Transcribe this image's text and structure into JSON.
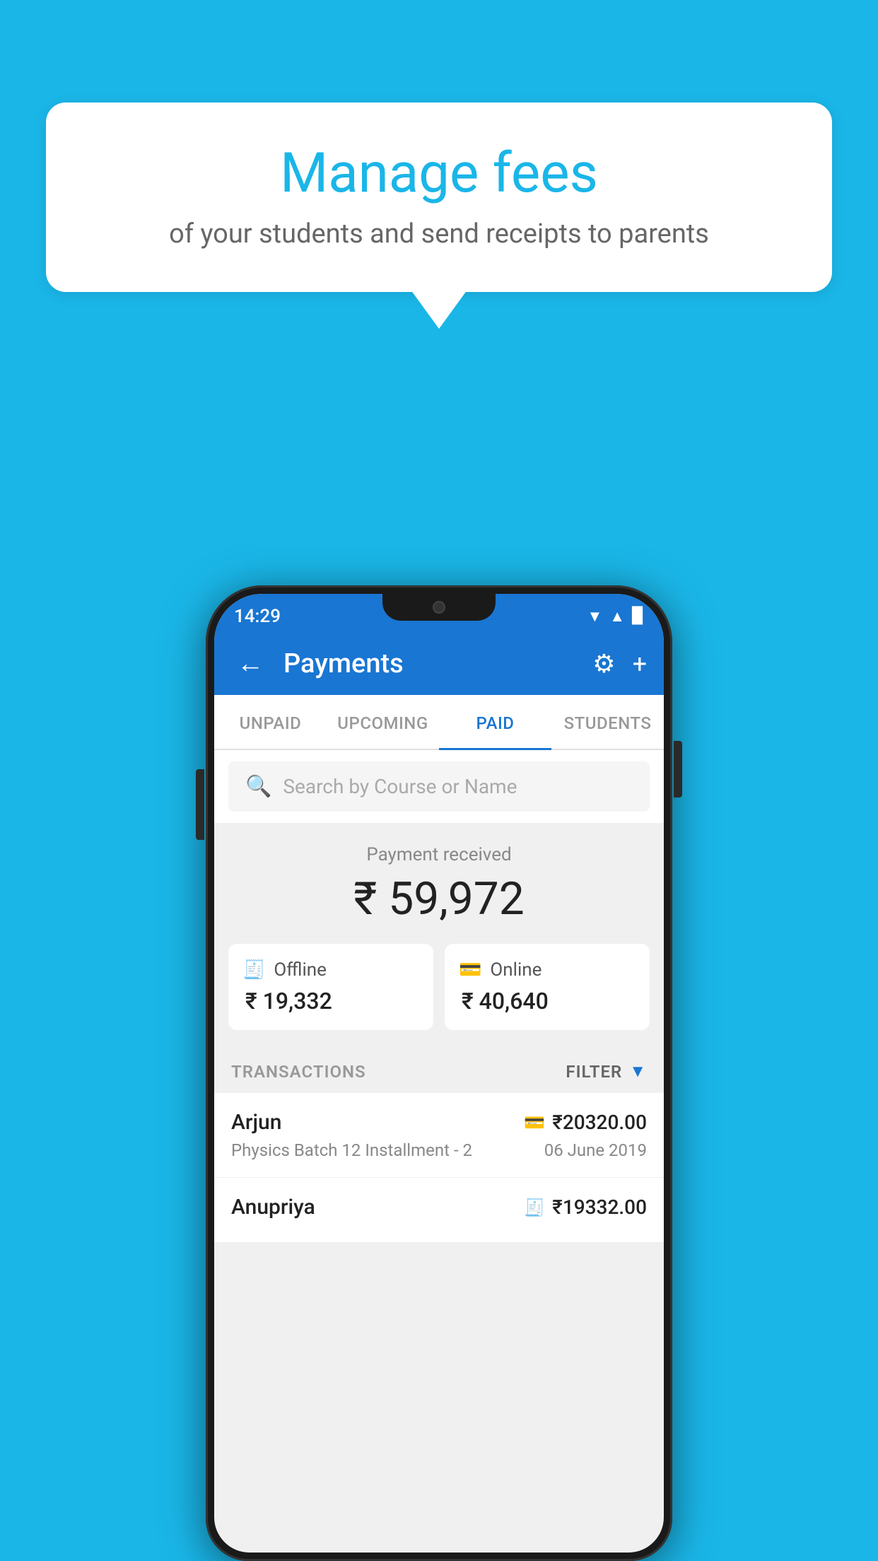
{
  "background_color": "#1ab6e8",
  "speech_bubble": {
    "title": "Manage fees",
    "subtitle": "of your students and send receipts to parents"
  },
  "status_bar": {
    "time": "14:29",
    "wifi": "▲",
    "signal": "▲",
    "battery": "▉"
  },
  "app_bar": {
    "title": "Payments",
    "back_label": "←",
    "gear_label": "⚙",
    "plus_label": "+"
  },
  "tabs": [
    {
      "id": "unpaid",
      "label": "UNPAID",
      "active": false
    },
    {
      "id": "upcoming",
      "label": "UPCOMING",
      "active": false
    },
    {
      "id": "paid",
      "label": "PAID",
      "active": true
    },
    {
      "id": "students",
      "label": "STUDENTS",
      "active": false
    }
  ],
  "search": {
    "placeholder": "Search by Course or Name"
  },
  "payment_summary": {
    "label": "Payment received",
    "total": "₹ 59,972",
    "offline": {
      "type": "Offline",
      "amount": "₹ 19,332"
    },
    "online": {
      "type": "Online",
      "amount": "₹ 40,640"
    }
  },
  "transactions_section": {
    "label": "TRANSACTIONS",
    "filter_label": "FILTER"
  },
  "transactions": [
    {
      "name": "Arjun",
      "course": "Physics Batch 12 Installment - 2",
      "amount": "₹20320.00",
      "date": "06 June 2019",
      "method": "card"
    },
    {
      "name": "Anupriya",
      "course": "",
      "amount": "₹19332.00",
      "date": "",
      "method": "cash"
    }
  ]
}
